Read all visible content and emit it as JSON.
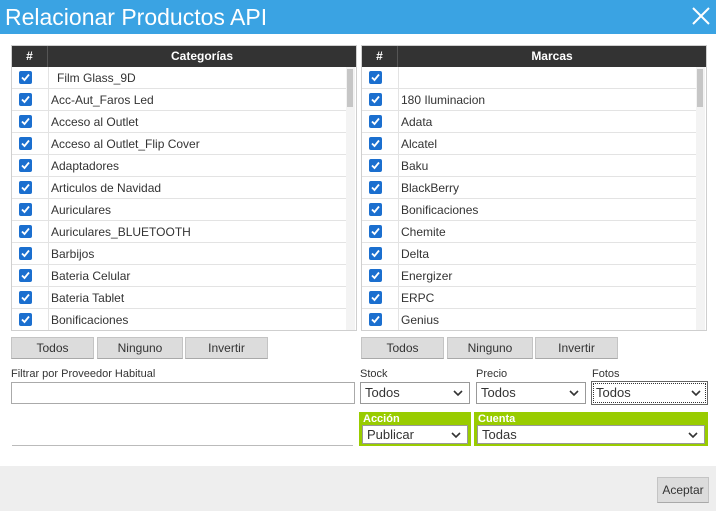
{
  "window": {
    "title": "Relacionar Productos API"
  },
  "categorias": {
    "header_hash": "#",
    "header": "Categorías",
    "items": [
      "Film Glass_9D",
      "Acc-Aut_Faros Led",
      "Acceso al Outlet",
      "Acceso al Outlet_Flip Cover",
      "Adaptadores",
      "Articulos de Navidad",
      "Auriculares",
      "Auriculares_BLUETOOTH",
      "Barbijos",
      "Bateria Celular",
      "Bateria Tablet",
      "Bonificaciones"
    ]
  },
  "marcas": {
    "header_hash": "#",
    "header": "Marcas",
    "items": [
      "",
      "180 Iluminacion",
      "Adata",
      "Alcatel",
      "Baku",
      "BlackBerry",
      "Bonificaciones",
      "Chemite",
      "Delta",
      "Energizer",
      "ERPC",
      "Genius"
    ]
  },
  "buttons": {
    "todos": "Todos",
    "ninguno": "Ninguno",
    "invertir": "Invertir",
    "aceptar": "Aceptar"
  },
  "filters": {
    "proveedor_label": "Filtrar por Proveedor Habitual",
    "proveedor_value": "",
    "stock_label": "Stock",
    "stock_value": "Todos",
    "precio_label": "Precio",
    "precio_value": "Todos",
    "fotos_label": "Fotos",
    "fotos_value": "Todos",
    "accion_label": "Acción",
    "accion_value": "Publicar",
    "cuenta_label": "Cuenta",
    "cuenta_value": "Todas"
  },
  "colors": {
    "titlebar": "#3aa3e3",
    "header": "#333333",
    "checkbox": "#1b6fcf",
    "green": "#99cc00"
  }
}
